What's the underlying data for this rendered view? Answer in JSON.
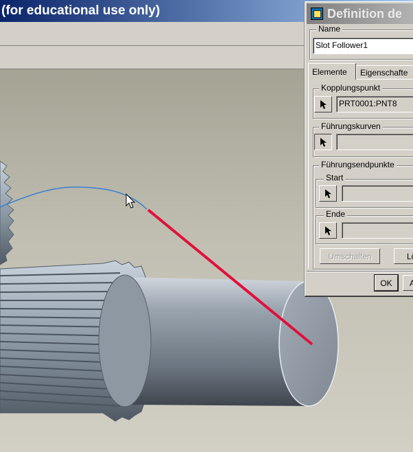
{
  "main_window": {
    "title": "(for educational use only)"
  },
  "dialog": {
    "title": "Definition de",
    "icon": "window-icon",
    "name_group": {
      "label": "Name",
      "value": "Slot Follower1"
    },
    "tabs": [
      {
        "label": "Elemente",
        "active": true
      },
      {
        "label": "Eigenschafte",
        "active": false
      }
    ],
    "kopplungspunkt": {
      "label": "Kopplungspunkt",
      "value": "PRT0001:PNT8"
    },
    "fuehrungskurven": {
      "label": "Führungskurven",
      "value": ""
    },
    "fuehrungsendpunkte": {
      "label": "Führungsendpunkte",
      "start": {
        "label": "Start",
        "value": ""
      },
      "ende": {
        "label": "Ende",
        "value": ""
      }
    },
    "buttons": {
      "umschalten": "Umschalten",
      "loeschen": "Lö",
      "ok": "OK",
      "abbrechen": "A"
    }
  },
  "viewport": {
    "colors": {
      "slot_curve": "#3a7fd0",
      "follower_line": "#e0103a",
      "shaft": "#8c96a2",
      "background": "#c0bdb0"
    }
  }
}
